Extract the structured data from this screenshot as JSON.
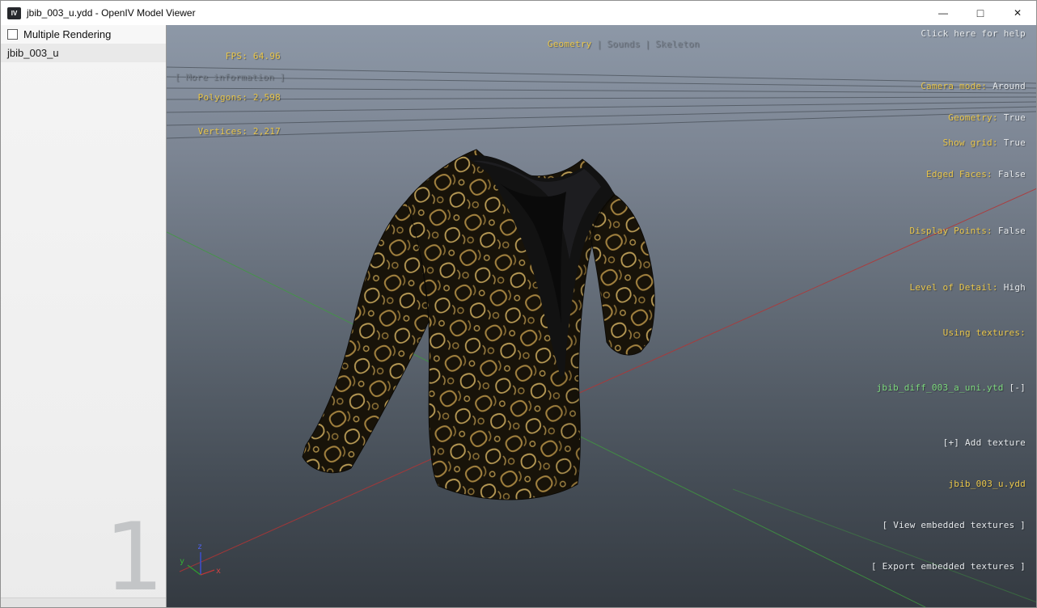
{
  "window": {
    "title": "jbib_003_u.ydd - OpenIV Model Viewer",
    "icon_label": "IV",
    "controls": {
      "minimize": "—",
      "maximize": "□",
      "close": "✕"
    }
  },
  "sidebar": {
    "multiple_rendering": "Multiple Rendering",
    "model_name": "jbib_003_u",
    "page_watermark": "1"
  },
  "viewport": {
    "stats": {
      "fps": "FPS: 64.96",
      "polygons": "Polygons: 2,598",
      "vertices": "Vertices: 2,217",
      "more_info": "[ More information ]"
    },
    "tabs": [
      {
        "label": "Geometry",
        "active": true
      },
      {
        "label": "Sounds",
        "active": false
      },
      {
        "label": "Skeleton",
        "active": false
      }
    ],
    "tab_separator": "|",
    "help": "Click here for help",
    "camera": [
      {
        "label": "Camera mode:",
        "value": "Around"
      },
      {
        "label": "Show grid:",
        "value": "True"
      }
    ],
    "render_flags": [
      {
        "label": "Geometry:",
        "value": "True"
      },
      {
        "label": "Edged Faces:",
        "value": "False"
      },
      {
        "label": "Display Points:",
        "value": "False"
      },
      {
        "label": "Level of Detail:",
        "value": "High"
      }
    ],
    "textures": {
      "heading": "Using textures:",
      "texture_name": "jbib_diff_003_a_uni.ytd",
      "remove_button": "[-]",
      "add_button": "[+] Add texture",
      "file_name": "jbib_003_u.ydd",
      "view_button": "[ View embedded textures ]",
      "export_button": "[ Export embedded textures ]"
    },
    "axis": {
      "x": "x",
      "y": "y",
      "z": "z"
    },
    "colors": {
      "accent_yellow": "#e9c64a",
      "texture_green": "#7cd87c",
      "axis_red": "#c03636",
      "axis_green": "#3fae3f",
      "axis_blue": "#3d4fd0"
    }
  }
}
